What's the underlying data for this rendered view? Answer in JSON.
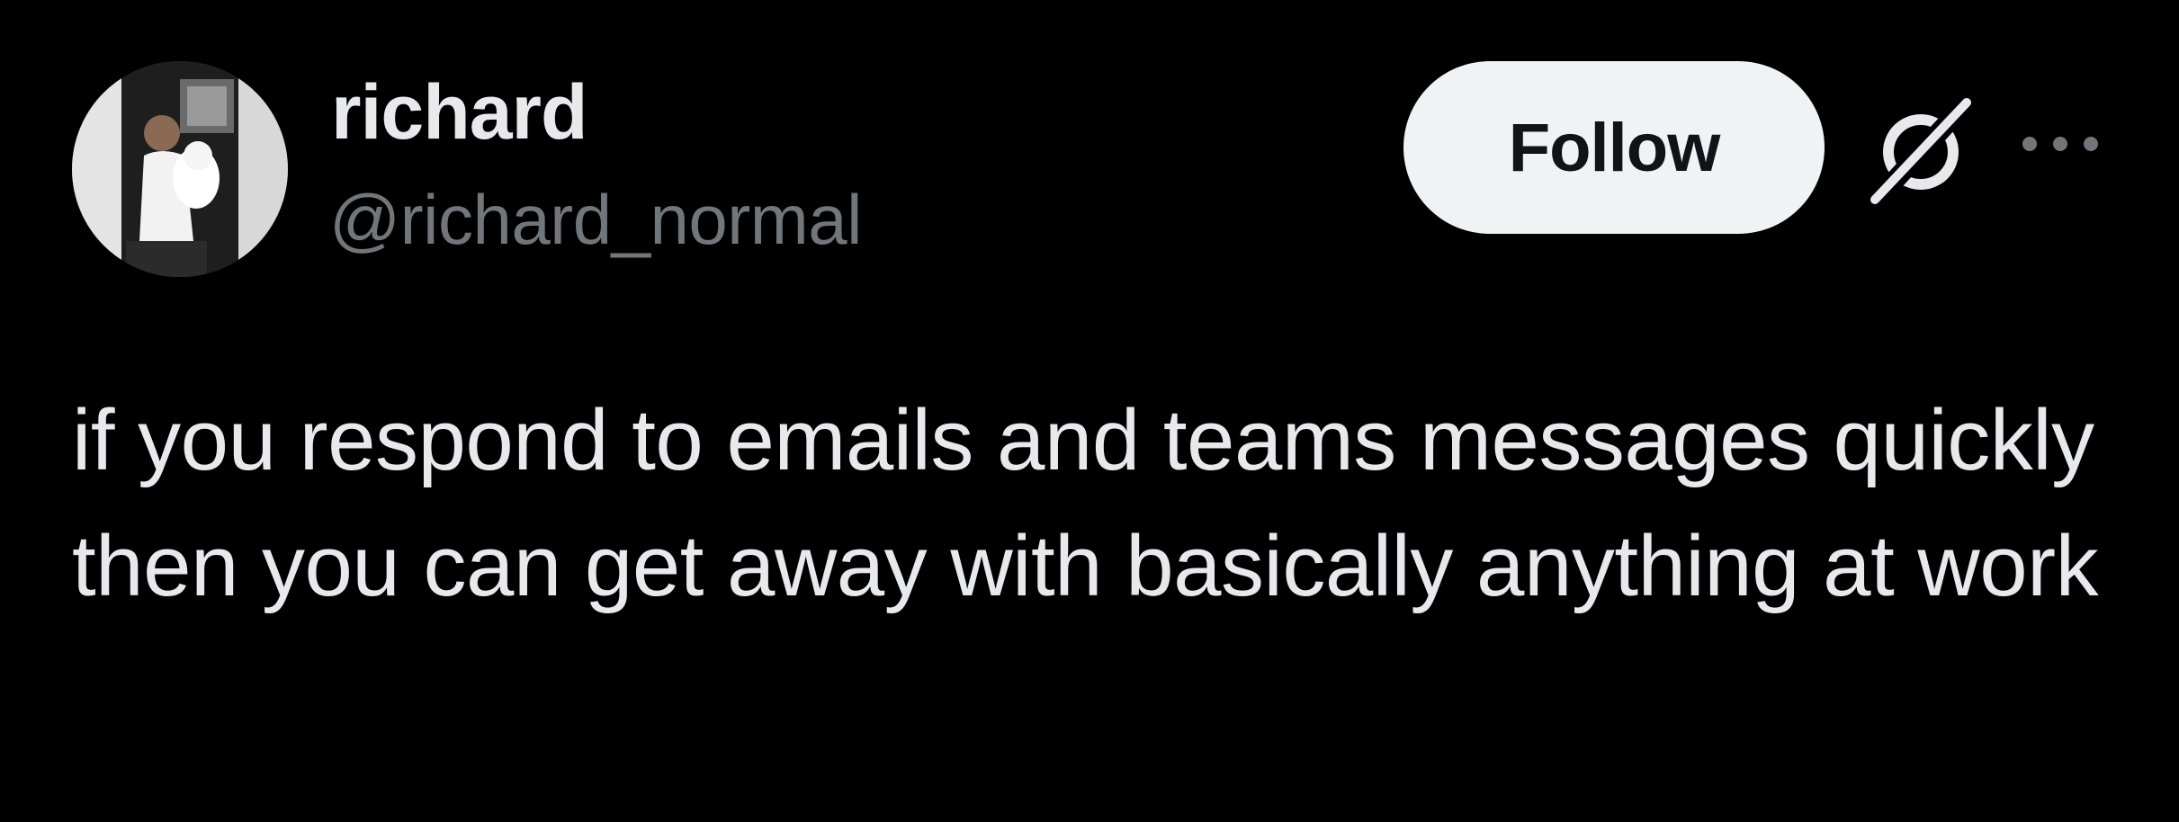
{
  "author": {
    "display_name": "richard",
    "handle": "@richard_normal"
  },
  "actions": {
    "follow_label": "Follow",
    "grok_icon": "grok-icon",
    "more_icon": "more-icon"
  },
  "tweet": {
    "text": "if you respond to emails and teams messages quickly then you can get away with basically anything at work"
  },
  "colors": {
    "background": "#000000",
    "primary_text": "#e7e9ea",
    "secondary_text": "#71767b",
    "follow_button_bg": "#eff3f4",
    "follow_button_text": "#0f1419"
  }
}
